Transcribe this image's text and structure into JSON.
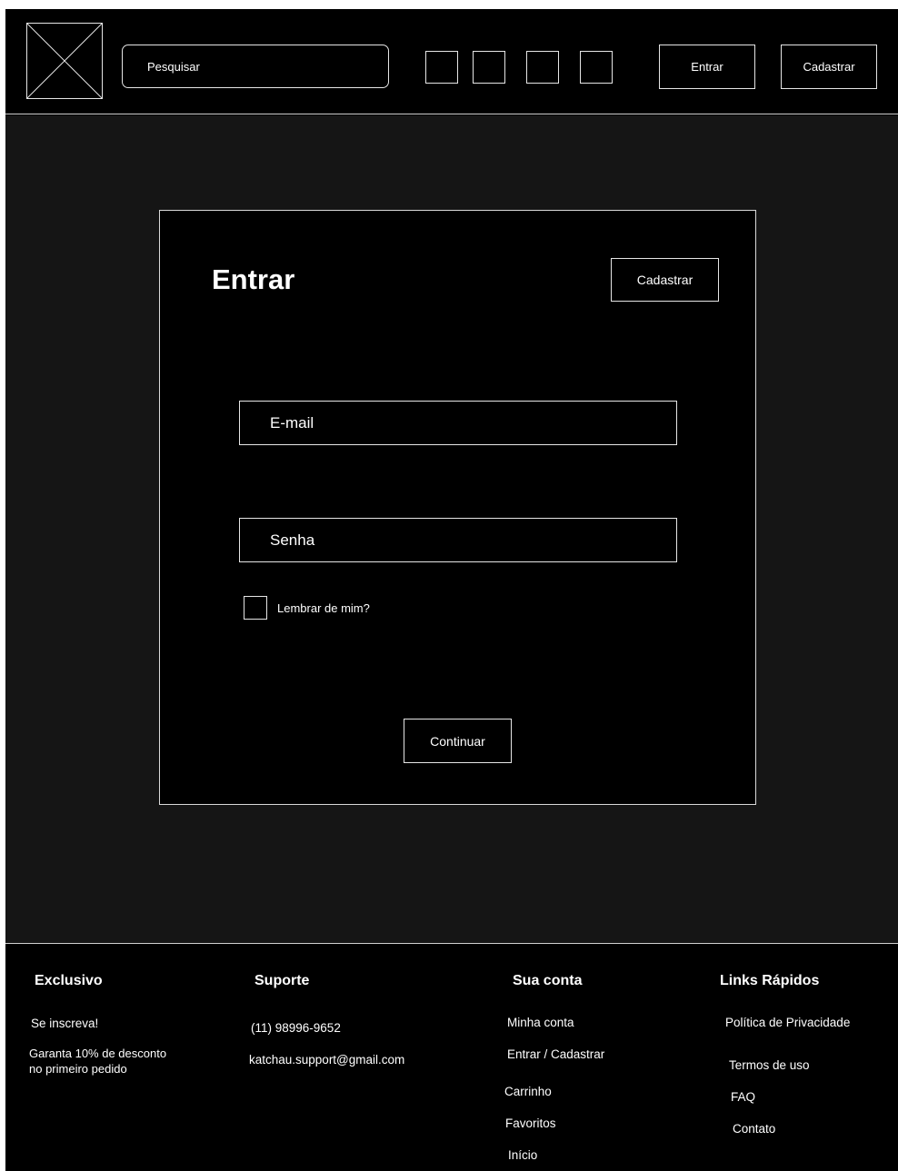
{
  "header": {
    "search_placeholder": "Pesquisar",
    "login_label": "Entrar",
    "signup_label": "Cadastrar"
  },
  "card": {
    "title": "Entrar",
    "signup_label": "Cadastrar",
    "email_placeholder": "E-mail",
    "password_placeholder": "Senha",
    "remember_label": "Lembrar de  mim?",
    "continue_label": "Continuar"
  },
  "footer": {
    "exclusive": {
      "heading": "Exclusivo",
      "subscribe": "Se inscreva!",
      "discount_line1": "Garanta 10% de desconto",
      "discount_line2": "no primeiro pedido"
    },
    "support": {
      "heading": "Suporte",
      "phone": "(11) 98996-9652",
      "email": "katchau.support@gmail.com"
    },
    "account": {
      "heading": "Sua conta",
      "links": [
        "Minha conta",
        "Entrar / Cadastrar",
        "Carrinho",
        "Favoritos",
        "Início"
      ]
    },
    "quick_links": {
      "heading": "Links Rápidos",
      "links": [
        "Política de Privacidade",
        "Termos de uso",
        "FAQ",
        "Contato"
      ]
    }
  }
}
